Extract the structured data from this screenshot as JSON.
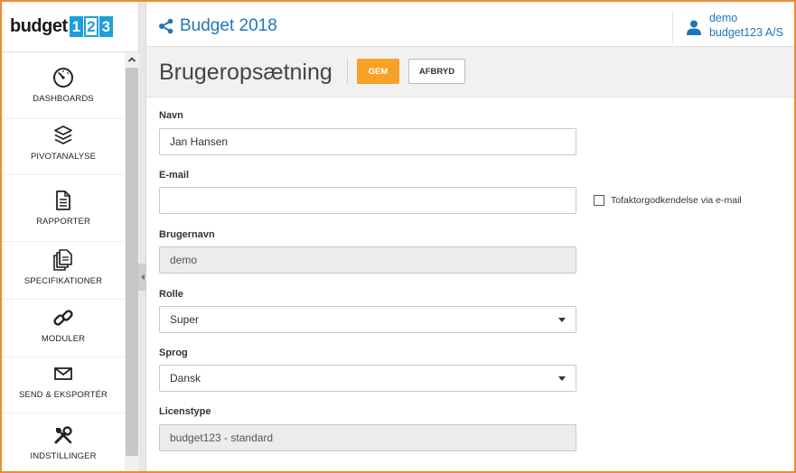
{
  "logo": {
    "text": "budget",
    "digits": [
      "1",
      "2",
      "3"
    ]
  },
  "sidebar": {
    "items": [
      {
        "label": "DASHBOARDS",
        "icon": "gauge-icon"
      },
      {
        "label": "PIVOTANALYSE",
        "icon": "layers-icon"
      },
      {
        "label": "RAPPORTER",
        "icon": "document-icon"
      },
      {
        "label": "SPECIFIKATIONER",
        "icon": "documents-icon"
      },
      {
        "label": "MODULER",
        "icon": "link-icon"
      },
      {
        "label": "SEND & EKSPORTÉR",
        "icon": "envelope-icon"
      },
      {
        "label": "INDSTILLINGER",
        "icon": "tools-icon"
      }
    ]
  },
  "topbar": {
    "title": "Budget 2018",
    "user": {
      "name": "demo",
      "company": "budget123 A/S"
    }
  },
  "header": {
    "title": "Brugeropsætning",
    "save_label": "GEM",
    "cancel_label": "AFBRYD"
  },
  "form": {
    "name": {
      "label": "Navn",
      "value": "Jan Hansen"
    },
    "email": {
      "label": "E-mail",
      "value": ""
    },
    "two_factor": {
      "label": "Tofaktorgodkendelse via e-mail",
      "checked": false
    },
    "username": {
      "label": "Brugernavn",
      "value": "demo"
    },
    "role": {
      "label": "Rolle",
      "value": "Super"
    },
    "language": {
      "label": "Sprog",
      "value": "Dansk"
    },
    "license": {
      "label": "Licenstype",
      "value": "budget123 - standard"
    }
  },
  "colors": {
    "accent": "#f7a128",
    "link": "#2176b8",
    "frame": "#f28a2e",
    "logo_blue": "#1e9fd9"
  }
}
